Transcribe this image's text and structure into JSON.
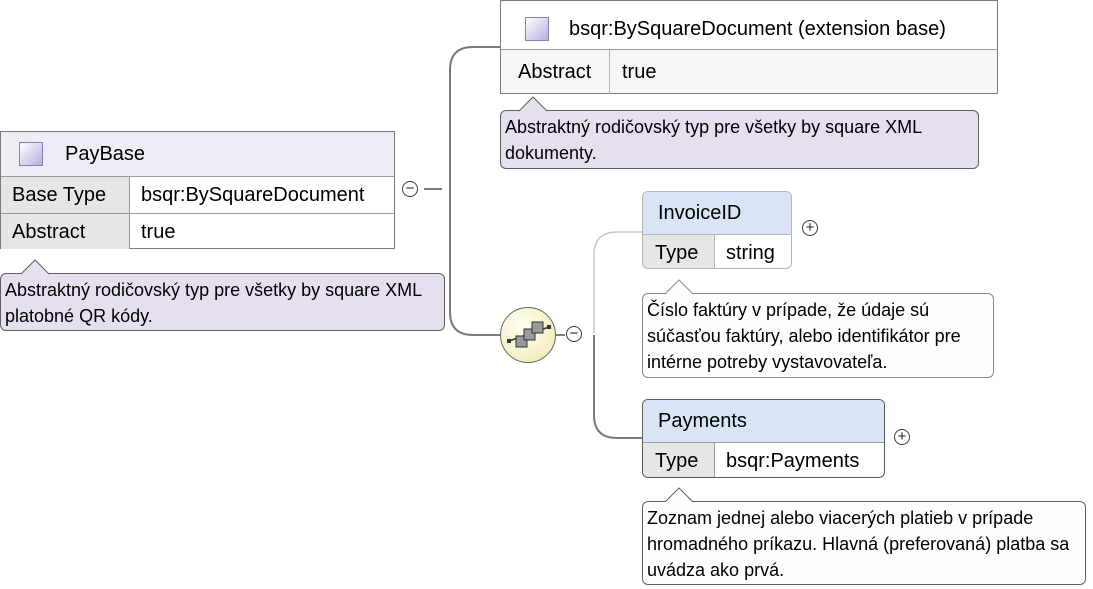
{
  "base_element": {
    "name": "PayBase",
    "rows": [
      {
        "key": "Base Type",
        "value": "bsqr:BySquareDocument"
      },
      {
        "key": "Abstract",
        "value": "true"
      }
    ],
    "note": "Abstraktný rodičovský typ pre všetky by square XML platobné QR kódy."
  },
  "extension_base": {
    "name": "bsqr:BySquareDocument (extension base)",
    "rows": [
      {
        "key": "Abstract",
        "value": "true"
      }
    ],
    "note": "Abstraktný rodičovský typ pre všetky by square XML dokumenty."
  },
  "children": [
    {
      "name": "InvoiceID",
      "rows": [
        {
          "key": "Type",
          "value": "string"
        }
      ],
      "note": "Číslo faktúry v prípade, že údaje sú súčasťou faktúry, alebo identifikátor pre intérne potreby vystavovateľa."
    },
    {
      "name": "Payments",
      "rows": [
        {
          "key": "Type",
          "value": "bsqr:Payments"
        }
      ],
      "note": "Zoznam jednej alebo viacerých platieb v prípade hromadného príkazu. Hlavná (preferovaná) platba sa uvádza ako prvá."
    }
  ],
  "toggles": {
    "collapse": "−",
    "expand": "+"
  },
  "colors": {
    "type_header": "#f0ecf6",
    "element_header": "#d9e5f6",
    "note_purple": "#e6dfee",
    "note_white": "#fdfdfd"
  }
}
